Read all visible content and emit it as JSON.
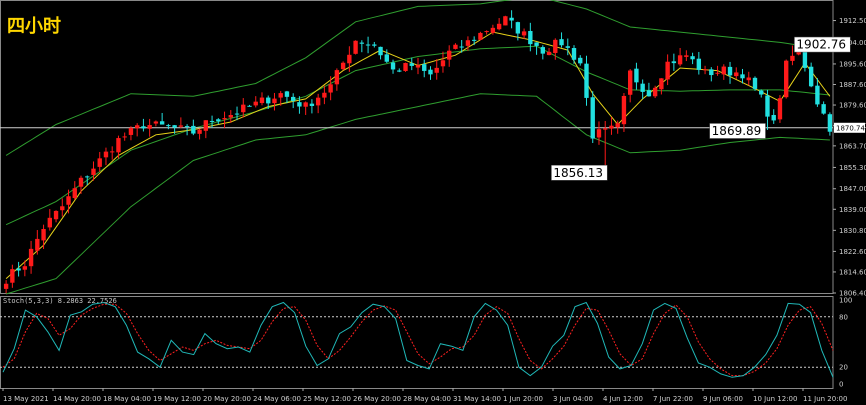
{
  "timeframe_label": "四小时",
  "indicator_label": "Stoch(5,3,3) 8.2863 22.7526",
  "colors": {
    "background": "#000000",
    "bull": "#ff1a1a",
    "bear": "#22e0e0",
    "bollinger": "#2f9e2f",
    "ma": "#e6d21a",
    "stoch_main": "#20b8b8",
    "stoch_signal": "#ff2020",
    "grid_text": "#d0d0d0",
    "annotation_bg": "#ffffff",
    "annotation_text": "#000000"
  },
  "chart_data": [
    {
      "type": "candlestick",
      "title": "四小时",
      "ylim": [
        1806.4,
        1920.5
      ],
      "y_ticks": [
        "1912.50",
        "1904.00",
        "1895.60",
        "1887.60",
        "1879.60",
        "1871.60",
        "1863.70",
        "1855.30",
        "1847.00",
        "1839.00",
        "1830.80",
        "1822.60",
        "1814.60",
        "1806.40"
      ],
      "current_price": "1870.74",
      "current_price_value": 1870.74,
      "x_ticks": [
        "13 May 2021",
        "14 May 20:00",
        "18 May 04:00",
        "19 May 12:00",
        "20 May 20:00",
        "24 May 06:00",
        "25 May 12:00",
        "26 May 20:00",
        "28 May 04:00",
        "31 May 14:00",
        "1 Jun 20:00",
        "3 Jun 04:00",
        "4 Jun 12:00",
        "7 Jun 22:00",
        "9 Jun 06:00",
        "10 Jun 12:00",
        "11 Jun 20:00"
      ],
      "annotations": [
        {
          "label": "1902.76",
          "value": 1902.76,
          "bar_index": 126
        },
        {
          "label": "1869.89",
          "value": 1869.89,
          "bar_index": 122
        },
        {
          "label": "1856.13",
          "value": 1856.13,
          "bar_index": 96
        }
      ],
      "close_path": [
        [
          0,
          1812
        ],
        [
          3,
          1818
        ],
        [
          6,
          1832
        ],
        [
          9,
          1840
        ],
        [
          12,
          1850
        ],
        [
          15,
          1858
        ],
        [
          18,
          1866
        ],
        [
          22,
          1872
        ],
        [
          26,
          1871
        ],
        [
          30,
          1869
        ],
        [
          33,
          1874
        ],
        [
          36,
          1876
        ],
        [
          40,
          1880
        ],
        [
          44,
          1884
        ],
        [
          48,
          1879
        ],
        [
          52,
          1887
        ],
        [
          56,
          1905
        ],
        [
          59,
          1903
        ],
        [
          62,
          1893
        ],
        [
          65,
          1895
        ],
        [
          68,
          1891
        ],
        [
          71,
          1900
        ],
        [
          74,
          1904
        ],
        [
          77,
          1909
        ],
        [
          80,
          1913
        ],
        [
          83,
          1907
        ],
        [
          86,
          1901
        ],
        [
          89,
          1904
        ],
        [
          92,
          1896
        ],
        [
          94,
          1868
        ],
        [
          96,
          1869
        ],
        [
          98,
          1871
        ],
        [
          100,
          1892
        ],
        [
          103,
          1884
        ],
        [
          106,
          1896
        ],
        [
          109,
          1899
        ],
        [
          112,
          1892
        ],
        [
          115,
          1893
        ],
        [
          118,
          1892
        ],
        [
          121,
          1882
        ],
        [
          123,
          1872
        ],
        [
          125,
          1895
        ],
        [
          127,
          1902
        ],
        [
          130,
          1881
        ],
        [
          132,
          1871
        ]
      ],
      "bollinger_upper": [
        [
          0,
          1860
        ],
        [
          8,
          1872
        ],
        [
          20,
          1884
        ],
        [
          30,
          1883
        ],
        [
          40,
          1888
        ],
        [
          48,
          1898
        ],
        [
          56,
          1912
        ],
        [
          66,
          1918
        ],
        [
          76,
          1919
        ],
        [
          85,
          1922
        ],
        [
          93,
          1917
        ],
        [
          100,
          1910
        ],
        [
          108,
          1908
        ],
        [
          116,
          1906
        ],
        [
          124,
          1904
        ],
        [
          132,
          1901
        ]
      ],
      "bollinger_lower": [
        [
          0,
          1806
        ],
        [
          8,
          1812
        ],
        [
          20,
          1840
        ],
        [
          30,
          1858
        ],
        [
          40,
          1866
        ],
        [
          48,
          1868
        ],
        [
          56,
          1874
        ],
        [
          66,
          1879
        ],
        [
          76,
          1884
        ],
        [
          85,
          1883
        ],
        [
          93,
          1868
        ],
        [
          100,
          1861
        ],
        [
          108,
          1862
        ],
        [
          116,
          1865
        ],
        [
          124,
          1867
        ],
        [
          132,
          1866
        ]
      ],
      "ma": [
        [
          0,
          1812
        ],
        [
          6,
          1825
        ],
        [
          12,
          1846
        ],
        [
          18,
          1860
        ],
        [
          24,
          1868
        ],
        [
          30,
          1870
        ],
        [
          36,
          1873
        ],
        [
          42,
          1879
        ],
        [
          48,
          1882
        ],
        [
          54,
          1893
        ],
        [
          60,
          1901
        ],
        [
          66,
          1895
        ],
        [
          72,
          1899
        ],
        [
          78,
          1908
        ],
        [
          84,
          1905
        ],
        [
          90,
          1901
        ],
        [
          94,
          1884
        ],
        [
          98,
          1872
        ],
        [
          102,
          1882
        ],
        [
          108,
          1894
        ],
        [
          114,
          1893
        ],
        [
          120,
          1886
        ],
        [
          124,
          1881
        ],
        [
          128,
          1896
        ],
        [
          132,
          1883
        ]
      ]
    },
    {
      "type": "line",
      "title": "Stoch(5,3,3)",
      "series": [
        {
          "name": "8.2863",
          "values": [
            14,
            42,
            88,
            80,
            62,
            40,
            82,
            86,
            95,
            97,
            92,
            70,
            38,
            30,
            20,
            52,
            38,
            35,
            60,
            48,
            42,
            44,
            38,
            70,
            92,
            97,
            85,
            45,
            22,
            30,
            60,
            68,
            85,
            95,
            92,
            78,
            28,
            22,
            18,
            48,
            45,
            40,
            80,
            96,
            88,
            70,
            20,
            10,
            20,
            45,
            58,
            92,
            97,
            72,
            32,
            18,
            22,
            48,
            88,
            96,
            90,
            55,
            25,
            20,
            12,
            8,
            10,
            20,
            35,
            58,
            96,
            95,
            85,
            40,
            8
          ]
        },
        {
          "name": "22.7526",
          "values": [
            20,
            30,
            62,
            84,
            78,
            58,
            66,
            82,
            90,
            95,
            95,
            84,
            60,
            40,
            28,
            36,
            44,
            40,
            48,
            52,
            46,
            44,
            42,
            52,
            74,
            90,
            92,
            76,
            46,
            30,
            40,
            56,
            74,
            88,
            93,
            88,
            62,
            36,
            24,
            32,
            42,
            44,
            58,
            82,
            92,
            84,
            54,
            28,
            18,
            30,
            45,
            70,
            90,
            88,
            64,
            36,
            22,
            30,
            60,
            84,
            94,
            80,
            50,
            30,
            18,
            10,
            10,
            15,
            25,
            42,
            70,
            88,
            92,
            72,
            40
          ]
        }
      ],
      "levels": [
        80,
        20
      ],
      "y_ticks": [
        "100",
        "80",
        "20",
        "0"
      ]
    }
  ]
}
